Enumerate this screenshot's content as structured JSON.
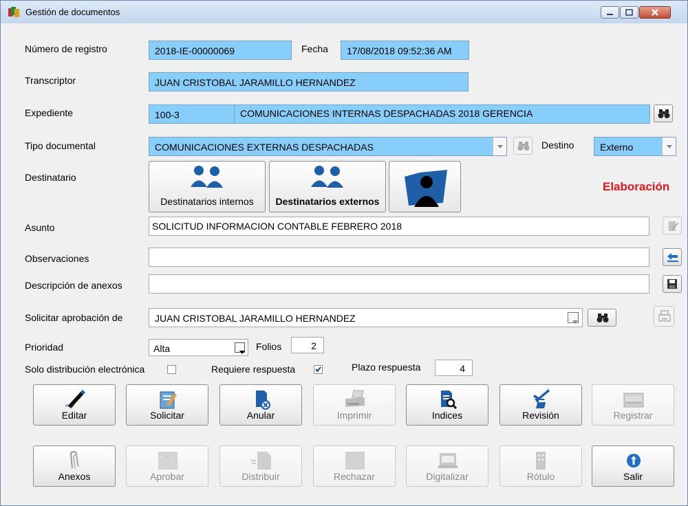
{
  "window": {
    "title": "Gestión de documentos"
  },
  "form": {
    "registro_label": "Número de registro",
    "registro_value": "2018-IE-00000069",
    "fecha_label": "Fecha",
    "fecha_value": "17/08/2018 09:52:36 AM",
    "transcriptor_label": "Transcriptor",
    "transcriptor_value": "JUAN CRISTOBAL JARAMILLO HERNANDEZ",
    "expediente_label": "Expediente",
    "expediente_code": "100-3",
    "expediente_name": "COMUNICACIONES INTERNAS DESPACHADAS 2018 GERENCIA",
    "tipo_label": "Tipo documental",
    "tipo_value": "COMUNICACIONES EXTERNAS DESPACHADAS",
    "destino_label": "Destino",
    "destino_value": "Externo",
    "destinatario_label": "Destinatario",
    "dest_internos": "Destinatarios internos",
    "dest_externos": "Destinatarios externos",
    "status": "Elaboración",
    "asunto_label": "Asunto",
    "asunto_value": "SOLICITUD INFORMACION CONTABLE FEBRERO 2018",
    "observaciones_label": "Observaciones",
    "observaciones_value": "",
    "anexos_label": "Descripción de anexos",
    "anexos_value": "",
    "aprobacion_label": "Solicitar aprobación de",
    "aprobacion_value": "JUAN CRISTOBAL JARAMILLO HERNANDEZ",
    "prioridad_label": "Prioridad",
    "prioridad_value": "Alta",
    "folios_label": "Folios",
    "folios_value": "2",
    "solo_label": "Solo distribución electrónica",
    "solo_checked": false,
    "requiere_label": "Requiere respuesta",
    "requiere_checked": true,
    "plazo_label": "Plazo respuesta",
    "plazo_value": "4"
  },
  "actions": {
    "row1": [
      "Editar",
      "Solicitar",
      "Anular",
      "Imprimir",
      "Indices",
      "Revisión",
      "Registrar"
    ],
    "row2": [
      "Anexos",
      "Aprobar",
      "Distribuir",
      "Rechazar",
      "Digitalizar",
      "Rótulo",
      "Salir"
    ]
  },
  "colors": {
    "field_bg": "#87cefa",
    "status": "#e8141b",
    "icon_blue": "#1f5fa8"
  }
}
